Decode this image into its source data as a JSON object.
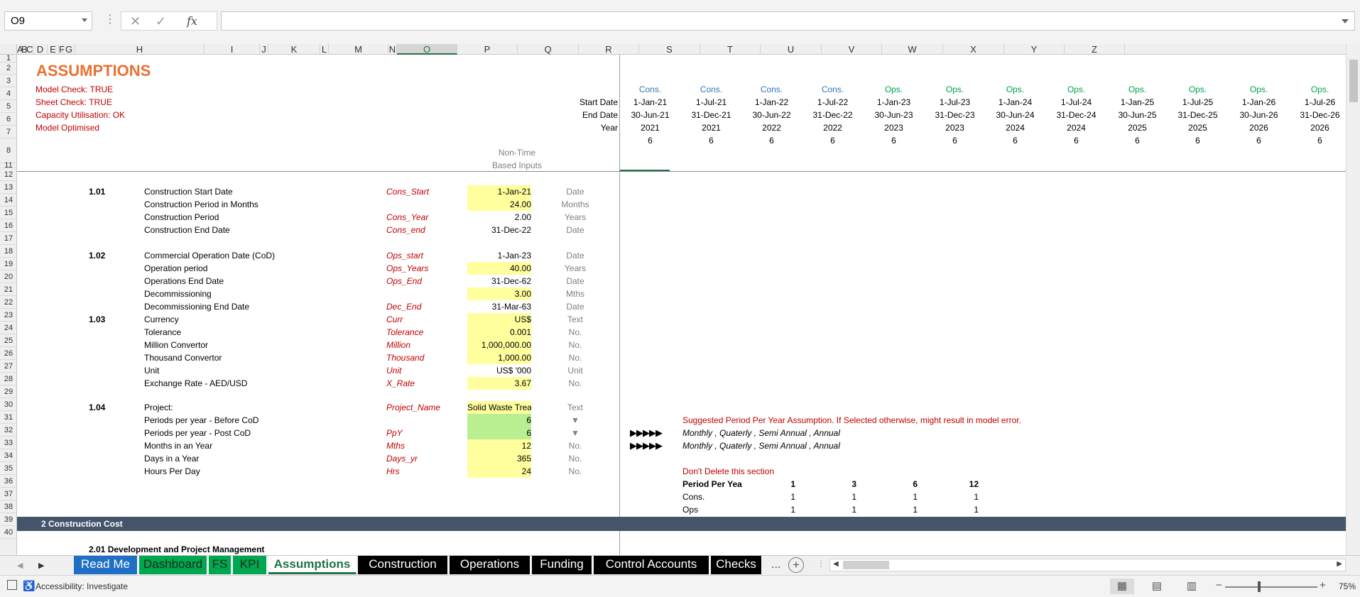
{
  "formula_bar": {
    "cell_ref": "O9",
    "formula": "",
    "fx_label": "fx",
    "cancel_icon": "✕",
    "enter_icon": "✓"
  },
  "col_headers": [
    "A",
    "B",
    "C",
    "D",
    "E",
    "F",
    "G",
    "H",
    "I",
    "J",
    "K",
    "L",
    "M",
    "N",
    "O",
    "P",
    "Q",
    "R",
    "S",
    "T",
    "U",
    "V",
    "W",
    "X",
    "Y",
    "Z"
  ],
  "selected_col": "O",
  "row_numbers": [
    "1",
    "2",
    "3",
    "4",
    "5",
    "6",
    "7",
    "8",
    "11",
    "12",
    "13",
    "14",
    "15",
    "16",
    "17",
    "18",
    "19",
    "20",
    "21",
    "22",
    "23",
    "24",
    "25",
    "26",
    "27",
    "28",
    "29",
    "30",
    "31",
    "32",
    "33",
    "34",
    "35",
    "36",
    "37",
    "38",
    "39",
    "40"
  ],
  "title": "ASSUMPTIONS",
  "checks": [
    "Model Check: TRUE",
    "Sheet Check: TRUE",
    "Capacity Utilisation: OK",
    "Model Optimised"
  ],
  "timeline": {
    "row_labels": [
      "Start Date",
      "End Date",
      "Year"
    ],
    "periods": [
      {
        "phase": "Cons.",
        "start": "1-Jan-21",
        "end": "30-Jun-21",
        "year": "2021",
        "n": "6"
      },
      {
        "phase": "Cons.",
        "start": "1-Jul-21",
        "end": "31-Dec-21",
        "year": "2021",
        "n": "6"
      },
      {
        "phase": "Cons.",
        "start": "1-Jan-22",
        "end": "30-Jun-22",
        "year": "2022",
        "n": "6"
      },
      {
        "phase": "Cons.",
        "start": "1-Jul-22",
        "end": "31-Dec-22",
        "year": "2022",
        "n": "6"
      },
      {
        "phase": "Ops.",
        "start": "1-Jan-23",
        "end": "30-Jun-23",
        "year": "2023",
        "n": "6"
      },
      {
        "phase": "Ops.",
        "start": "1-Jul-23",
        "end": "31-Dec-23",
        "year": "2023",
        "n": "6"
      },
      {
        "phase": "Ops.",
        "start": "1-Jan-24",
        "end": "30-Jun-24",
        "year": "2024",
        "n": "6"
      },
      {
        "phase": "Ops.",
        "start": "1-Jul-24",
        "end": "31-Dec-24",
        "year": "2024",
        "n": "6"
      },
      {
        "phase": "Ops.",
        "start": "1-Jan-25",
        "end": "30-Jun-25",
        "year": "2025",
        "n": "6"
      },
      {
        "phase": "Ops.",
        "start": "1-Jul-25",
        "end": "31-Dec-25",
        "year": "2025",
        "n": "6"
      },
      {
        "phase": "Ops.",
        "start": "1-Jan-26",
        "end": "30-Jun-26",
        "year": "2026",
        "n": "6"
      },
      {
        "phase": "Ops.",
        "start": "1-Jul-26",
        "end": "31-Dec-26",
        "year": "2026",
        "n": "6"
      }
    ]
  },
  "non_time_header": [
    "Non-Time",
    "Based Inputs"
  ],
  "sections": [
    {
      "id": "1.01",
      "rows": [
        {
          "label": "Construction Start Date",
          "name": "Cons_Start",
          "value": "1-Jan-21",
          "unit": "Date",
          "style": "yel"
        },
        {
          "label": "Construction Period in Months",
          "name": "",
          "value": "24.00",
          "unit": "Months",
          "style": "yel"
        },
        {
          "label": "Construction Period",
          "name": "Cons_Year",
          "value": "2.00",
          "unit": "Years",
          "style": ""
        },
        {
          "label": "Construction End Date",
          "name": "Cons_end",
          "value": "31-Dec-22",
          "unit": "Date",
          "style": ""
        }
      ]
    },
    {
      "id": "1.02",
      "rows": [
        {
          "label": "Commercial Operation Date (CoD)",
          "name": "Ops_start",
          "value": "1-Jan-23",
          "unit": "Date",
          "style": ""
        },
        {
          "label": "Operation period",
          "name": "Ops_Years",
          "value": "40.00",
          "unit": "Years",
          "style": "yel"
        },
        {
          "label": "Operations End Date",
          "name": "Ops_End",
          "value": "31-Dec-62",
          "unit": "Date",
          "style": ""
        },
        {
          "label": "Decommissioning",
          "name": "",
          "value": "3.00",
          "unit": "Mths",
          "style": "yel"
        },
        {
          "label": "Decommissioning End Date",
          "name": "Dec_End",
          "value": "31-Mar-63",
          "unit": "Date",
          "style": ""
        }
      ]
    },
    {
      "id": "1.03",
      "rows": [
        {
          "label": "Currency",
          "name": "Curr",
          "value": "US$",
          "unit": "Text",
          "style": "yel"
        },
        {
          "label": "Tolerance",
          "name": "Tolerance",
          "value": "0.001",
          "unit": "No.",
          "style": "yel"
        },
        {
          "label": "Million Convertor",
          "name": "Million",
          "value": "1,000,000.00",
          "unit": "No.",
          "style": "yel"
        },
        {
          "label": "Thousand Convertor",
          "name": "Thousand",
          "value": "1,000.00",
          "unit": "No.",
          "style": "yel"
        },
        {
          "label": "Unit",
          "name": "Unit",
          "value": "US$ '000",
          "unit": "Unit",
          "style": ""
        },
        {
          "label": "Exchange Rate - AED/USD",
          "name": "X_Rate",
          "value": "3.67",
          "unit": "No.",
          "style": "yel"
        }
      ]
    },
    {
      "id": "1.04",
      "rows": [
        {
          "label": "Project:",
          "name": "Project_Name",
          "value": "Solid Waste Treat",
          "unit": "Text",
          "style": "yel"
        },
        {
          "label": "Periods per year - Before CoD",
          "name": "",
          "value": "6",
          "unit": "▼",
          "style": "grn"
        },
        {
          "label": "Periods per year - Post CoD",
          "name": "PpY",
          "value": "6",
          "unit": "▼",
          "style": "grn"
        },
        {
          "label": "Months in an Year",
          "name": "Mths",
          "value": "12",
          "unit": "No.",
          "style": "yel"
        },
        {
          "label": "Days in a Year",
          "name": "Days_yr",
          "value": "365",
          "unit": "No.",
          "style": "yel"
        },
        {
          "label": "Hours Per Day",
          "name": "Hrs",
          "value": "24",
          "unit": "No.",
          "style": "yel"
        }
      ]
    }
  ],
  "note_right": {
    "suggestion": "Suggested Period Per Year Assumption. If Selected otherwise, might result in model error.",
    "arrows": "▶▶▶▶▶",
    "options_1": "Monthly ,  Quaterly ,  Semi Annual ,  Annual",
    "options_2": "Monthly ,  Quaterly ,  Semi Annual ,  Annual",
    "dont_delete": "Don't Delete this section",
    "ppy_label": "Period Per Yea",
    "ppy_values": [
      "1",
      "3",
      "6",
      "12"
    ],
    "cons_label": "Cons.",
    "cons_values": [
      "1",
      "1",
      "1",
      "1"
    ],
    "ops_label": "Ops",
    "ops_values": [
      "1",
      "1",
      "1",
      "1"
    ]
  },
  "section2": {
    "bar_label": "2  Construction Cost",
    "sub": "2.01  Development and Project Management"
  },
  "tabs": [
    {
      "label": "Read Me",
      "style": "blue"
    },
    {
      "label": "Dashboard",
      "style": "green"
    },
    {
      "label": "FS",
      "style": "green"
    },
    {
      "label": "KPI",
      "style": "green"
    },
    {
      "label": "Assumptions",
      "style": "active"
    },
    {
      "label": "Construction",
      "style": "black"
    },
    {
      "label": "Operations",
      "style": "black"
    },
    {
      "label": "Funding",
      "style": "black"
    },
    {
      "label": "Control Accounts",
      "style": "black"
    },
    {
      "label": "Checks",
      "style": "black"
    }
  ],
  "tab_overflow": "...",
  "add_sheet": "+",
  "status": {
    "accessibility": "Accessibility: Investigate",
    "zoom": "75%",
    "minus": "−",
    "plus": "+"
  },
  "colors": {
    "title": "#e97132",
    "check_red": "#c00000",
    "cons_blue": "#2e75b6",
    "ops_green": "#00a24a",
    "section_bar": "#44546a",
    "input_yellow": "#ffff9e",
    "input_green": "#b9ee91"
  }
}
